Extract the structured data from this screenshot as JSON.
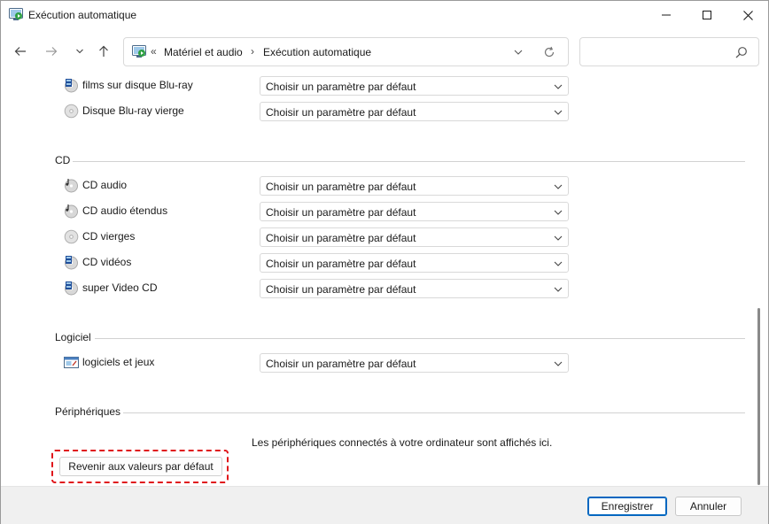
{
  "window": {
    "title": "Exécution automatique",
    "controls": {
      "minimize": "minimize",
      "maximize": "maximize",
      "close": "close"
    }
  },
  "address_bar": {
    "overflow": "«",
    "crumbs": [
      "Matériel et audio",
      "Exécution automatique"
    ],
    "separator": "›",
    "search_placeholder": ""
  },
  "default_option": "Choisir un paramètre par défaut",
  "sections": {
    "bluray": {
      "items": [
        {
          "label": "films sur disque Blu-ray",
          "icon": "bluray-movie-icon",
          "value": "Choisir un paramètre par défaut"
        },
        {
          "label": "Disque Blu-ray vierge",
          "icon": "blank-disc-icon",
          "value": "Choisir un paramètre par défaut"
        }
      ]
    },
    "cd": {
      "title": "CD",
      "items": [
        {
          "label": "CD audio",
          "icon": "audio-cd-icon",
          "value": "Choisir un paramètre par défaut"
        },
        {
          "label": "CD audio étendus",
          "icon": "enhanced-audio-cd-icon",
          "value": "Choisir un paramètre par défaut"
        },
        {
          "label": "CD vierges",
          "icon": "blank-cd-icon",
          "value": "Choisir un paramètre par défaut"
        },
        {
          "label": "CD vidéos",
          "icon": "video-cd-icon",
          "value": "Choisir un paramètre par défaut"
        },
        {
          "label": "super Video CD",
          "icon": "super-video-cd-icon",
          "value": "Choisir un paramètre par défaut"
        }
      ]
    },
    "software": {
      "title": "Logiciel",
      "items": [
        {
          "label": "logiciels et jeux",
          "icon": "software-games-icon",
          "value": "Choisir un paramètre par défaut"
        }
      ]
    },
    "devices": {
      "title": "Périphériques",
      "message": "Les périphériques connectés à votre ordinateur sont affichés ici."
    }
  },
  "reset_button": "Revenir aux valeurs par défaut",
  "footer": {
    "save": "Enregistrer",
    "cancel": "Annuler"
  },
  "colors": {
    "accent": "#0067c0",
    "highlight": "#e0161b",
    "footer_bg": "#f0f0f0"
  }
}
